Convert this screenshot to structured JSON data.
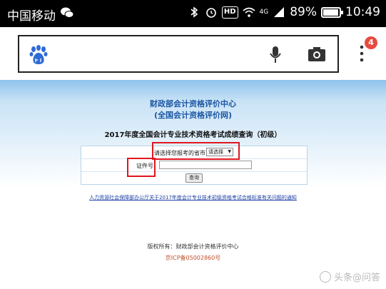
{
  "status_bar": {
    "carrier": "中国移动",
    "battery": "89%",
    "time": "10:49",
    "hd": "HD",
    "network": "4G",
    "battery_level": 0.89
  },
  "browser": {
    "notification_count": "4"
  },
  "page": {
    "org_line1": "财政部会计资格评价中心",
    "org_line2": "(全国会计资格评价网)",
    "query_title": "2017年度全国会计专业技术资格考试成绩查询（初级）",
    "province_label": "请选择您报考的省市:",
    "province_select": "请选择",
    "id_label": "证件号:",
    "id_value": "",
    "query_button": "查询",
    "notice_link": "人力资源社会保障部办公厅关于2017年度会计专业技术初级资格考试合格标准有关问题的通知",
    "copyright": "版权所有：财政部会计资格评价中心",
    "icp": "京ICP备05002860号"
  },
  "watermark": "头条@问答",
  "colors": {
    "highlight": "#e0161f",
    "org_title": "#1d56a3",
    "badge": "#e84a3f"
  }
}
